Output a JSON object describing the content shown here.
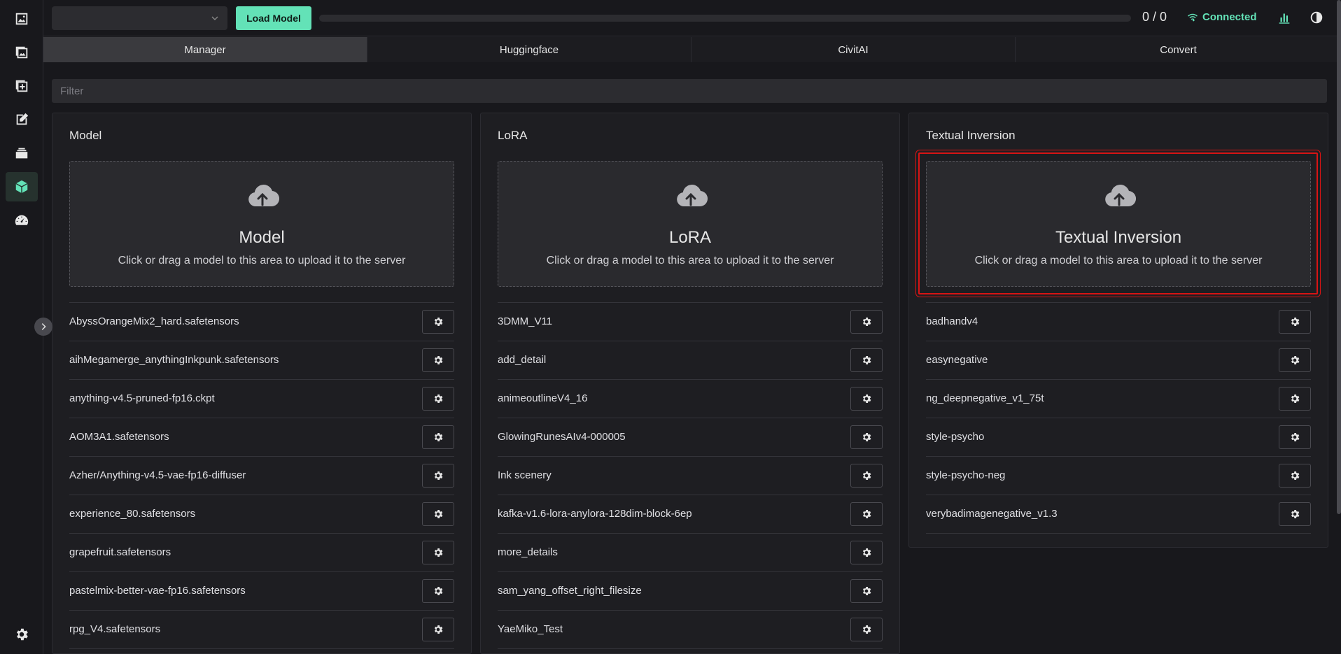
{
  "topbar": {
    "model_select_value": "",
    "load_button": "Load Model",
    "progress": 0,
    "counter": "0 / 0",
    "connection_status": "Connected"
  },
  "tabs": [
    {
      "label": "Manager",
      "active": true
    },
    {
      "label": "Huggingface",
      "active": false
    },
    {
      "label": "CivitAI",
      "active": false
    },
    {
      "label": "Convert",
      "active": false
    }
  ],
  "filter": {
    "placeholder": "Filter",
    "value": ""
  },
  "dropzone_hint": "Click or drag a model to this area to upload it to the server",
  "cards": [
    {
      "title": "Model",
      "dropzone_title": "Model",
      "items": [
        "AbyssOrangeMix2_hard.safetensors",
        "aihMegamerge_anythingInkpunk.safetensors",
        "anything-v4.5-pruned-fp16.ckpt",
        "AOM3A1.safetensors",
        "Azher/Anything-v4.5-vae-fp16-diffuser",
        "experience_80.safetensors",
        "grapefruit.safetensors",
        "pastelmix-better-vae-fp16.safetensors",
        "rpg_V4.safetensors"
      ]
    },
    {
      "title": "LoRA",
      "dropzone_title": "LoRA",
      "items": [
        "3DMM_V11",
        "add_detail",
        "animeoutlineV4_16",
        "GlowingRunesAIv4-000005",
        "Ink scenery",
        "kafka-v1.6-lora-anylora-128dim-block-6ep",
        "more_details",
        "sam_yang_offset_right_filesize",
        "YaeMiko_Test"
      ]
    },
    {
      "title": "Textual Inversion",
      "dropzone_title": "Textual Inversion",
      "items": [
        "badhandv4",
        "easynegative",
        "ng_deepnegative_v1_75t",
        "style-psycho",
        "style-psycho-neg",
        "verybadimagenegative_v1.3"
      ]
    }
  ],
  "colors": {
    "accent": "#63e2b7",
    "highlight": "#d81414"
  },
  "sidebar_icons": [
    "image-icon",
    "images-icon",
    "add-image-icon",
    "edit-icon",
    "stack-icon",
    "cube-icon",
    "gauge-icon"
  ],
  "settings_icon": "gear-icon"
}
